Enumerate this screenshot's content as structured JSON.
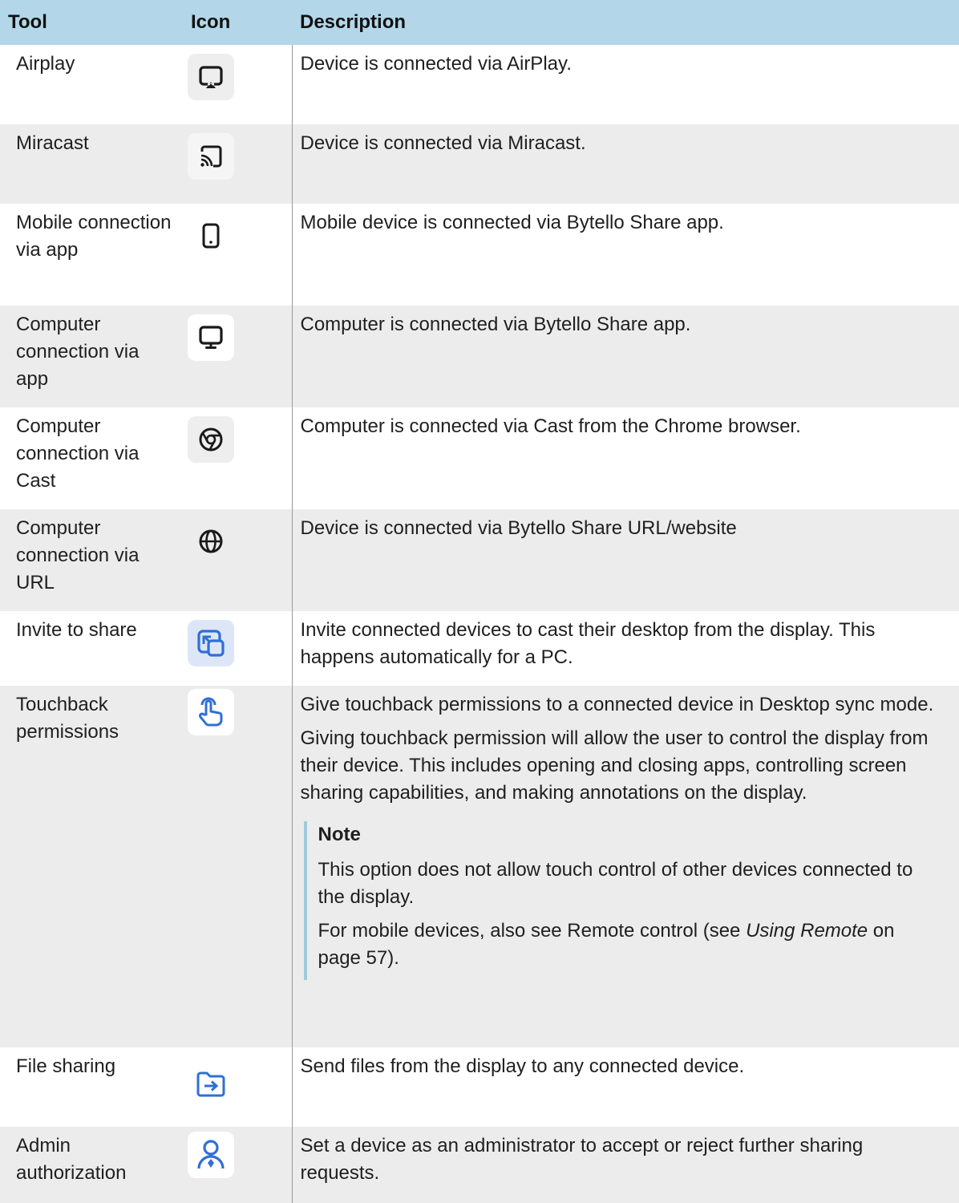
{
  "headers": {
    "tool": "Tool",
    "icon": "Icon",
    "description": "Description"
  },
  "rows": [
    {
      "tool": "Airplay",
      "icon": "airplay-icon",
      "description": "Device is connected via AirPlay."
    },
    {
      "tool": "Miracast",
      "icon": "miracast-icon",
      "description": "Device is connected via Miracast."
    },
    {
      "tool": "Mobile connection via app",
      "icon": "mobile-device-icon",
      "description": "Mobile device is connected via Bytello Share app."
    },
    {
      "tool": "Computer connection via app",
      "icon": "monitor-icon",
      "description": "Computer is connected via Bytello Share app."
    },
    {
      "tool": "Computer connection via Cast",
      "icon": "chrome-icon",
      "description": "Computer is connected via Cast from the Chrome browser."
    },
    {
      "tool": "Computer connection via URL",
      "icon": "globe-icon",
      "description": "Device is connected via Bytello Share URL/website"
    },
    {
      "tool": "Invite to share",
      "icon": "invite-share-icon",
      "description": "Invite connected devices to cast their desktop from the display. This happens automatically for a PC."
    },
    {
      "tool": "Touchback permissions",
      "icon": "touch-hand-icon",
      "description": "Give touchback permissions to a connected device in Desktop sync mode.",
      "description_2": "Giving touchback permission will allow the user to control the display from their device. This includes opening and closing apps, controlling screen sharing capabilities, and making annotations on the display.",
      "note": {
        "title": "Note",
        "text_1": "This option does not allow touch control of other devices connected to the display.",
        "text_2_prefix": "For mobile devices, also see Remote control (see ",
        "text_2_link": "Using Remote",
        "text_2_suffix": " on page 57)."
      }
    },
    {
      "tool": "File sharing",
      "icon": "file-share-icon",
      "description": "Send files from the display to any connected device."
    },
    {
      "tool": "Admin authorization",
      "icon": "admin-user-icon",
      "description": "Set a device as an administrator to accept or reject further sharing requests."
    }
  ],
  "colors": {
    "header_bg": "#b3d7e8",
    "stripe_bg": "#ececec",
    "accent_blue": "#2f6fd6",
    "note_border": "#9fcadc"
  }
}
